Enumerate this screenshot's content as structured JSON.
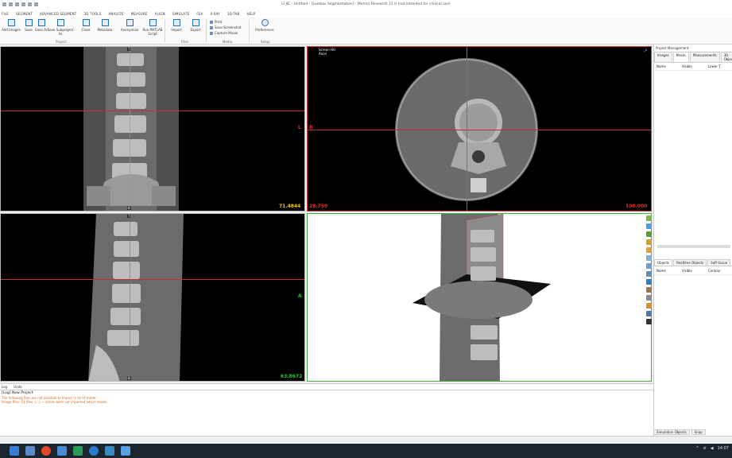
{
  "window": {
    "title": "LI JIE - Untitled - [Lumbar Segmentation] - Mimics Research 21.0 (not intended for clinical use)"
  },
  "menu": [
    "FILE",
    "SEGMENT",
    "ADVANCED SEGMENT",
    "3D TOOLS",
    "ANALYZE",
    "MEASURE",
    "ALIGN",
    "SIMULATE",
    "FEA",
    "X-RAY",
    "3D-TAB",
    "HELP"
  ],
  "ribbon": {
    "buttons": [
      "Add Images",
      "Save",
      "Save As",
      "Save Subproject As",
      "Close",
      "Metadata",
      "Anonymize",
      "Run MATLAB Script",
      "Import",
      "Export",
      "Preferences"
    ],
    "small_actions": [
      "Print",
      "Save Screenshot",
      "Capture Movie"
    ],
    "groups": [
      "Project",
      "Files",
      "Media",
      "Setup"
    ]
  },
  "views": {
    "coronal": {
      "top_marker": "T",
      "bottom_marker": "B",
      "side_marker": "L",
      "value": "71.4844"
    },
    "axial": {
      "info_line1": "Screen HU",
      "info_line2": "Axial",
      "left_marker": "R",
      "value_left": "28.750",
      "value_right": "100.000"
    },
    "sagittal": {
      "top_marker": "T",
      "bottom_marker": "B",
      "side_marker": "A",
      "value": "63.8672"
    }
  },
  "log": {
    "tabs": [
      "Log",
      "Undo"
    ],
    "line1": "[Log] New Project",
    "line2": "The following files are not possible to import in strict mode:",
    "line3": "Image files: 11 files, (...) — series were not imported (strict mode)"
  },
  "right_panel": {
    "title": "Project Management",
    "tabs": [
      "Images",
      "Masks",
      "Measurements",
      "3D Objects"
    ],
    "headers": [
      "Name",
      "Visible",
      "Lower T"
    ],
    "tabs2": [
      "Objects",
      "Realtime Objects",
      "Soft tissue"
    ],
    "headers2": [
      "Name",
      "Visible",
      "Contour"
    ],
    "bottom_tabs": [
      "Simulation Objects",
      "Snap"
    ]
  },
  "tray": {
    "time": "14:07"
  },
  "colors": {
    "yellow": "#f0c000",
    "red": "#e03030",
    "green": "#30c030",
    "accent": "#2b6cb0"
  }
}
